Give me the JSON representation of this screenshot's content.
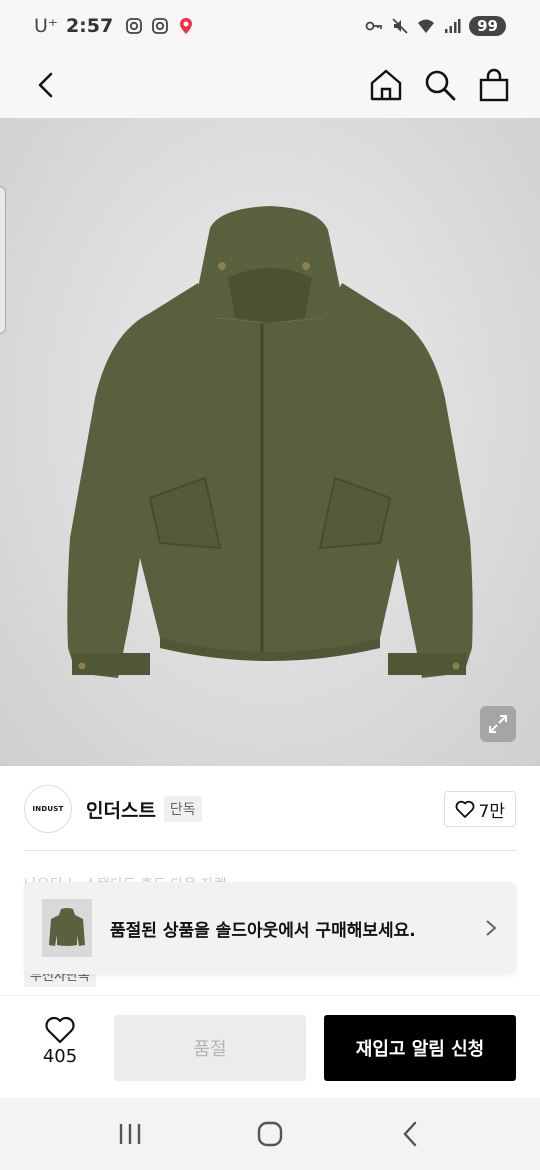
{
  "status": {
    "carrier": "U⁺",
    "time": "2:57",
    "battery": "99"
  },
  "brand": {
    "logo_text": "INDUST",
    "name": "인더스트",
    "badge": "단독",
    "likes": "7만"
  },
  "hidden_text": {
    "title_fragment": "나우티 노 스탠다드 후드 다운 자켓",
    "tag": "무신사단독"
  },
  "banner": {
    "text": "품절된 상품을 솔드아웃에서 구매해보세요."
  },
  "actions": {
    "wish_count": "405",
    "soldout_label": "품절",
    "restock_label": "재입고 알림 신청"
  },
  "colors": {
    "jacket": "#59613f",
    "primary_button": "#000000",
    "disabled_button": "#ececec"
  },
  "icons": [
    "back-icon",
    "home-icon",
    "search-icon",
    "bag-icon",
    "expand-icon",
    "heart-icon",
    "chevron-right-icon",
    "recents-icon",
    "home-circle-icon",
    "nav-back-icon"
  ]
}
